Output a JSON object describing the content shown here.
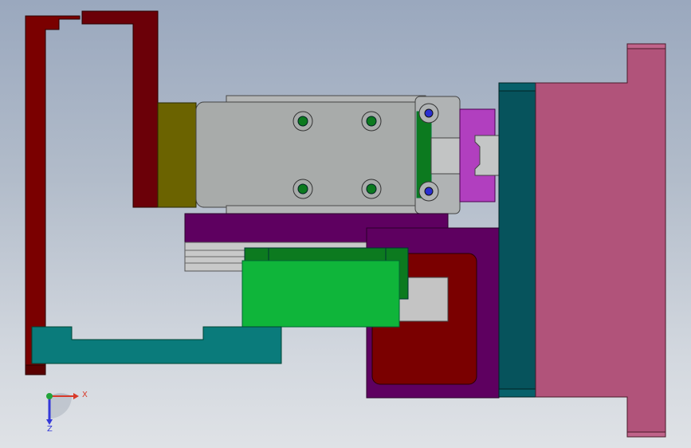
{
  "viewport": {
    "background": "gradient-gray-blue"
  },
  "colors": {
    "frame_dark_red": "#7a0000",
    "frame_edge": "#3a0000",
    "olive_block": "#6b6300",
    "gray_body": "#a7aaa8",
    "gray_light": "#c8c8c8",
    "purple": "#5e0060",
    "magenta": "#b13fbf",
    "green_dark": "#0c7a1f",
    "green_bright": "#0fb53a",
    "teal": "#0a7b7b",
    "teal_dark": "#06535c",
    "pink": "#b1537a",
    "screw_blue": "#2a2fd0"
  },
  "triad": {
    "x_label": "X",
    "z_label": "Z",
    "x_color": "#d83a2a",
    "z_color": "#3438d8",
    "y_color": "#22a33a"
  }
}
